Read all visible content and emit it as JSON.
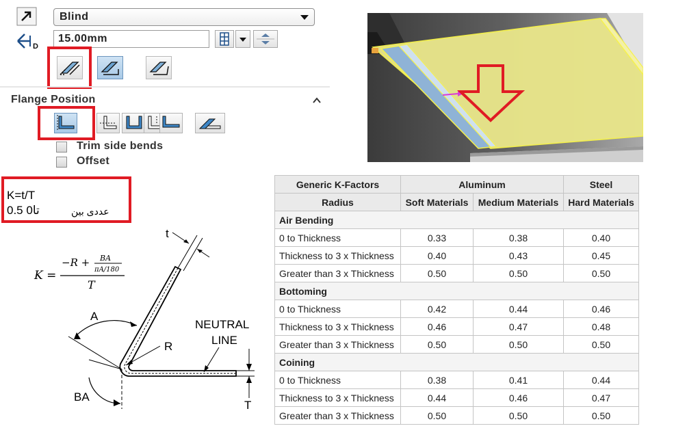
{
  "panel": {
    "end_condition": "Blind",
    "depth_value": "15.00mm",
    "flange_position_title": "Flange Position",
    "trim_side_bends_label": "Trim side bends",
    "offset_label": "Offset"
  },
  "formula_box": {
    "line1": "K=t/T",
    "line2_prefix": "0.5",
    "line2_mid": "0تا",
    "line2_arabic": "عددی بین"
  },
  "diagram": {
    "formula_lhs": "K =",
    "formula_num_main": "−R +",
    "formula_num_frac_top": "BA",
    "formula_num_frac_bottom": "πA/180",
    "formula_den": "T",
    "label_t": "t",
    "label_A": "A",
    "label_R": "R",
    "label_BA": "BA",
    "label_T": "T",
    "label_neutral_1": "NEUTRAL",
    "label_neutral_2": "LINE"
  },
  "table": {
    "header1": {
      "col0": "Generic K-Factors",
      "col1": "Aluminum",
      "col2": "Steel"
    },
    "header2": {
      "col0": "Radius",
      "col1": "Soft Materials",
      "col2": "Medium Materials",
      "col3": "Hard Materials"
    },
    "groups": [
      {
        "name": "Air Bending",
        "rows": [
          {
            "label": "0 to Thickness",
            "soft": "0.33",
            "medium": "0.38",
            "hard": "0.40"
          },
          {
            "label": "Thickness to 3 x Thickness",
            "soft": "0.40",
            "medium": "0.43",
            "hard": "0.45"
          },
          {
            "label": "Greater than 3 x Thickness",
            "soft": "0.50",
            "medium": "0.50",
            "hard": "0.50"
          }
        ]
      },
      {
        "name": "Bottoming",
        "rows": [
          {
            "label": "0 to Thickness",
            "soft": "0.42",
            "medium": "0.44",
            "hard": "0.46"
          },
          {
            "label": "Thickness to 3 x Thickness",
            "soft": "0.46",
            "medium": "0.47",
            "hard": "0.48"
          },
          {
            "label": "Greater than 3 x Thickness",
            "soft": "0.50",
            "medium": "0.50",
            "hard": "0.50"
          }
        ]
      },
      {
        "name": "Coining",
        "rows": [
          {
            "label": "0 to Thickness",
            "soft": "0.38",
            "medium": "0.41",
            "hard": "0.44"
          },
          {
            "label": "Thickness to 3 x Thickness",
            "soft": "0.44",
            "medium": "0.46",
            "hard": "0.47"
          },
          {
            "label": "Greater than 3 x Thickness",
            "soft": "0.50",
            "medium": "0.50",
            "hard": "0.50"
          }
        ]
      }
    ]
  },
  "colors": {
    "highlight_red": "#e01b24",
    "selected_blue": "#a8c9e6",
    "flange_yellow": "#e8e58a"
  }
}
